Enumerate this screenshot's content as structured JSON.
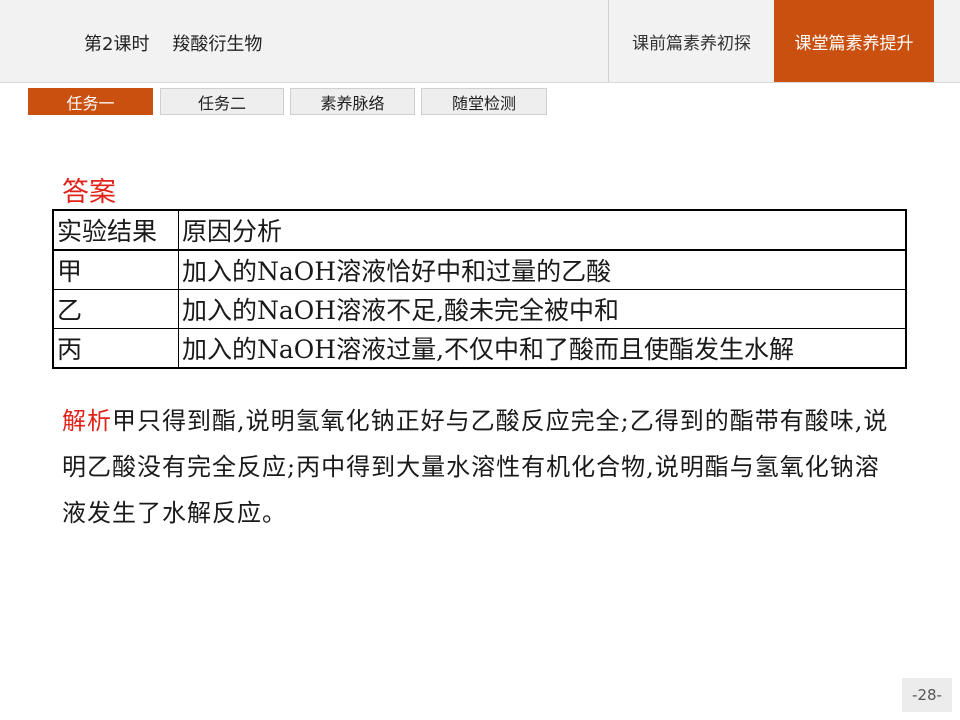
{
  "header": {
    "title": "第2课时    羧酸衍生物",
    "nav": [
      {
        "label": "课前篇素养初探",
        "active": false
      },
      {
        "label": "课堂篇素养提升",
        "active": true
      }
    ]
  },
  "tabs": [
    {
      "label": "任务一",
      "active": true
    },
    {
      "label": "任务二",
      "active": false
    },
    {
      "label": "素养脉络",
      "active": false
    },
    {
      "label": "随堂检测",
      "active": false
    }
  ],
  "answer": {
    "label": "答案",
    "table": {
      "headers": [
        "实验结果",
        "原因分析"
      ],
      "rows": [
        [
          "甲",
          "加入的NaOH溶液恰好中和过量的乙酸"
        ],
        [
          "乙",
          "加入的NaOH溶液不足,酸未完全被中和"
        ],
        [
          "丙",
          "加入的NaOH溶液过量,不仅中和了酸而且使酯发生水解"
        ]
      ]
    }
  },
  "analysis": {
    "label": "解析",
    "text": "甲只得到酯,说明氢氧化钠正好与乙酸反应完全;乙得到的酯带有酸味,说明乙酸没有完全反应;丙中得到大量水溶性有机化合物,说明酯与氢氧化钠溶液发生了水解反应。"
  },
  "page_number": "-28-",
  "colors": {
    "accent": "#c9500f",
    "answer_red": "#e0241b"
  }
}
